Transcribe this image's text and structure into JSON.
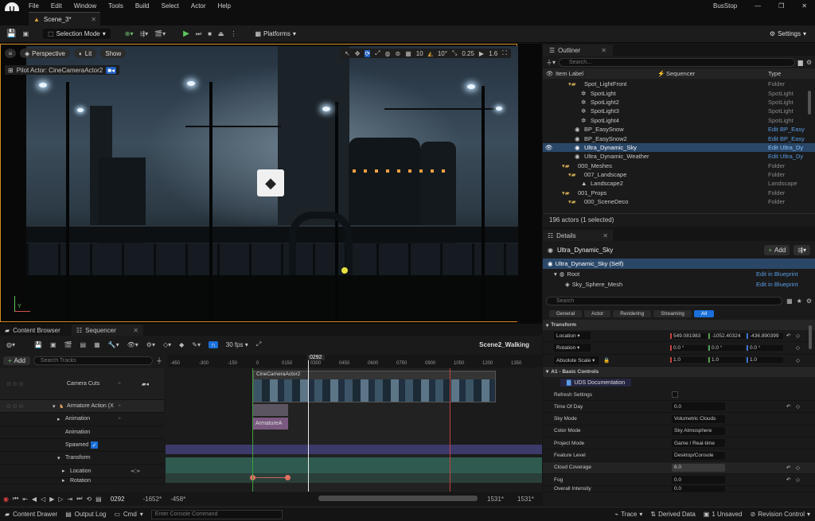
{
  "app": {
    "window_title": "BusStop",
    "menu": [
      "File",
      "Edit",
      "Window",
      "Tools",
      "Build",
      "Select",
      "Actor",
      "Help"
    ],
    "level_tab": "Scene_3*"
  },
  "toolbar": {
    "selection_mode": "Selection Mode",
    "platforms": "Platforms",
    "settings": "Settings"
  },
  "viewport": {
    "perspective": "Perspective",
    "lit": "Lit",
    "show": "Show",
    "pilot": "Pilot Actor: CineCameraActor2",
    "grid": "10",
    "angle": "10°",
    "scale": "0.25",
    "speed": "1.6",
    "axis_x": "X",
    "axis_y": "Y"
  },
  "outliner": {
    "tab": "Outliner",
    "search_placeholder": "Search...",
    "col_label": "Item Label",
    "col_sequencer": "Sequencer",
    "col_type": "Type",
    "rows": [
      {
        "label": "Spot_LightFront",
        "type": "Folder"
      },
      {
        "label": "SpotLight",
        "type": "SpotLight"
      },
      {
        "label": "SpotLight2",
        "type": "SpotLight"
      },
      {
        "label": "SpotLight3",
        "type": "SpotLight"
      },
      {
        "label": "SpotLight4",
        "type": "SpotLight"
      },
      {
        "label": "BP_EasySnow",
        "type": "Edit BP_Easy"
      },
      {
        "label": "BP_EasySnow2",
        "type": "Edit BP_Easy"
      },
      {
        "label": "Ultra_Dynamic_Sky",
        "type": "Edit Ultra_Dy"
      },
      {
        "label": "Ultra_Dynamic_Weather",
        "type": "Edit Ultra_Dy"
      },
      {
        "label": "000_Meshes",
        "type": "Folder"
      },
      {
        "label": "007_Landscape",
        "type": "Folder"
      },
      {
        "label": "Landscape2",
        "type": "Landscape"
      },
      {
        "label": "001_Props",
        "type": "Folder"
      },
      {
        "label": "000_SceneDeco",
        "type": "Folder"
      }
    ],
    "footer": "196 actors (1 selected)"
  },
  "details": {
    "tab": "Details",
    "actor": "Ultra_Dynamic_Sky",
    "add": "Add",
    "components": [
      {
        "label": "Ultra_Dynamic_Sky (Self)",
        "link": ""
      },
      {
        "label": "Root",
        "link": "Edit in Blueprint"
      },
      {
        "label": "Sky_Sphere_Mesh",
        "link": "Edit in Blueprint"
      }
    ],
    "search_placeholder": "Search",
    "filters": [
      "General",
      "Actor",
      "Rendering",
      "Streaming",
      "All"
    ],
    "transform_header": "Transform",
    "location_label": "Location",
    "location": [
      "549.081983",
      "-1052.40324",
      "-436.890399"
    ],
    "rotation_label": "Rotation",
    "rotation": [
      "0.0 °",
      "0.0 °",
      "0.0 °"
    ],
    "scale_label": "Absolute Scale",
    "scale": [
      "1.0",
      "1.0",
      "1.0"
    ],
    "basic_header": "A1 - Basic Controls",
    "uds_button": "UDS Documentation",
    "props": [
      {
        "label": "Refresh Settings",
        "value": ""
      },
      {
        "label": "Time Of Day",
        "value": "0.0"
      },
      {
        "label": "Sky Mode",
        "value": "Volumetric Clouds"
      },
      {
        "label": "Color Mode",
        "value": "Sky Atmosphere"
      },
      {
        "label": "Project Mode",
        "value": "Game / Real-time"
      },
      {
        "label": "Feature Level",
        "value": "Desktop/Console"
      },
      {
        "label": "Cloud Coverage",
        "value": "6.0"
      },
      {
        "label": "Fog",
        "value": "0.0"
      },
      {
        "label": "Overall Intensity",
        "value": "0.0"
      }
    ]
  },
  "sequencer": {
    "tabs": [
      "Content Browser",
      "Sequencer"
    ],
    "fps": "30 fps",
    "sequence_name": "Scene2_Walking",
    "add": "Add",
    "search_placeholder": "Search Tracks",
    "current_frame": "0292",
    "ruler": [
      "-450",
      "-300",
      "-150",
      "0",
      "0150",
      "0300",
      "0450",
      "0600",
      "0750",
      "0900",
      "1050",
      "1200",
      "1350"
    ],
    "tracks": [
      {
        "label": "Camera Cuts",
        "indent": 0
      },
      {
        "label": "Armature Action (X",
        "indent": 0
      },
      {
        "label": "Animation",
        "indent": 1
      },
      {
        "label": "Animation",
        "indent": 2
      },
      {
        "label": "Spawned",
        "indent": 2
      },
      {
        "label": "Transform",
        "indent": 1
      },
      {
        "label": "Location",
        "indent": 2
      },
      {
        "label": "Rotation",
        "indent": 2
      }
    ],
    "camera_clip": "CineCameraActor2",
    "anim_clip": "ArmatureA",
    "range_start": "-1652*",
    "range_end": "-458*",
    "view_start": "1531*",
    "view_end": "1531*"
  },
  "status": {
    "content_drawer": "Content Drawer",
    "output_log": "Output Log",
    "cmd": "Cmd",
    "console_placeholder": "Enter Console Command",
    "trace": "Trace",
    "derived": "Derived Data",
    "unsaved": "1 Unsaved",
    "revision": "Revision Control"
  }
}
